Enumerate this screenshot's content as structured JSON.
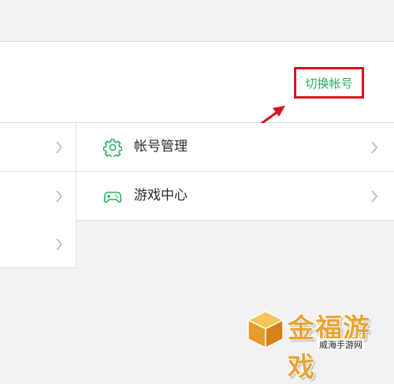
{
  "header": {
    "switch_account_label": "切换帐号"
  },
  "menu": {
    "items": [
      {
        "label": "帐号管理",
        "icon": "gear-icon"
      },
      {
        "label": "游戏中心",
        "icon": "gamepad-icon"
      }
    ]
  },
  "watermark": {
    "title": "金福游戏",
    "subtitle": "威海手游网"
  },
  "colors": {
    "accent_green": "#29b065",
    "highlight_red": "#d8141c",
    "watermark_orange": "#e7a53a"
  }
}
